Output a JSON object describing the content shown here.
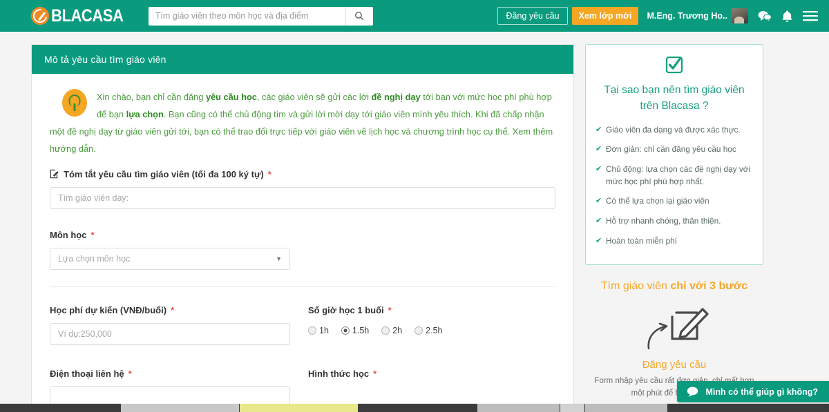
{
  "navbar": {
    "logo_text": "BLACASA",
    "logo_mark_icon": "blacasa-circle-logo-icon",
    "search": {
      "placeholder": "Tìm giáo viên theo môn học và địa điểm",
      "value": "",
      "icon": "search-icon"
    },
    "post_request_label": "Đăng yêu cầu",
    "new_class_label": "Xem lớp mới",
    "user_name": "M.Eng. Trương Ho..",
    "avatar_icon": "user-avatar",
    "messages_icon": "chat-bubbles-icon",
    "notifications_icon": "bell-icon",
    "menu_icon": "hamburger-menu-icon"
  },
  "main": {
    "panel_title": "Mô tả yêu cầu tìm giáo viên",
    "intro": {
      "bulb_icon": "lightbulb-icon",
      "part1": "Xin chào, bạn chỉ cần đăng ",
      "bold1": "yêu cầu học",
      "part2": ", các giáo viên sẽ gửi các lời ",
      "bold2": "đề nghị dạy",
      "part3": " tới bạn với mức học phí phù hợp để bạn ",
      "bold3": "lựa chọn",
      "part4": ". Bạn cũng có thể chủ động tìm và gửi lời mời dạy tới giáo viên mình yêu thích. Khi đã chấp nhận một đề nghị dạy từ giáo viên gửi tới, bạn có thể trao đổi trực tiếp với giáo viên về lịch học và chương trình học cụ thể. ",
      "link": "Xem thêm hướng dẫn."
    },
    "fields": {
      "summary": {
        "icon": "edit-pencil-icon",
        "label": "Tóm tắt yêu cầu tìm giáo viên (tối đa 100 ký tự)",
        "required": "*",
        "placeholder": "Tìm giáo viên dạy:",
        "value": ""
      },
      "subject": {
        "label": "Môn học",
        "required": "*",
        "selected": "Lựa chọn môn học",
        "caret_icon": "chevron-down-icon"
      },
      "fee": {
        "label": "Học phí dự kiến (VNĐ/buổi)",
        "required": "*",
        "placeholder": "Ví dụ:250,000",
        "value": ""
      },
      "hours": {
        "label": "Số giờ học 1 buổi",
        "required": "*",
        "options": [
          {
            "label": "1h",
            "selected": false
          },
          {
            "label": "1.5h",
            "selected": true
          },
          {
            "label": "2h",
            "selected": false
          },
          {
            "label": "2.5h",
            "selected": false
          }
        ]
      },
      "phone": {
        "label": "Điện thoại liên hệ",
        "required": "*",
        "placeholder": "",
        "value": ""
      },
      "mode": {
        "label": "Hình thức học",
        "required": "*"
      }
    }
  },
  "sidebar": {
    "why": {
      "check_icon": "checkbox-check-icon",
      "title": "Tại sao bạn nên tìm giáo viên trên Blacasa ?",
      "items": [
        "Giáo viên đa dạng và được xác thực.",
        "Đơn giản: chỉ cần đăng yêu cầu học",
        "Chủ động: lựa chọn các đề nghị dạy với mức học phí phù hợp nhất.",
        "Có thể lựa chọn lại giáo viên",
        "Hỗ trợ nhanh chóng, thân thiện.",
        "Hoàn toàn miễn phí"
      ]
    },
    "steps": {
      "title_normal": "Tìm giáo viên ",
      "title_bold": "chỉ với 3 bước",
      "step_icon": "note-pencil-icon",
      "arrow_icon": "curved-arrow-icon",
      "step_name": "Đăng yêu cầu",
      "step_desc": "Form nhập yêu cầu rất đơn giản, chỉ mất hơn một phút để hoàn thành."
    }
  },
  "chat_widget": {
    "icon": "chat-bubble-icon",
    "label": "Mình có thể giúp gì không?"
  },
  "colors": {
    "teal": "#0a9b7f",
    "orange": "#f5a623",
    "green_text": "#4b9a3e",
    "required_red": "#e8544a",
    "sidebar_border": "#aaddd3"
  }
}
